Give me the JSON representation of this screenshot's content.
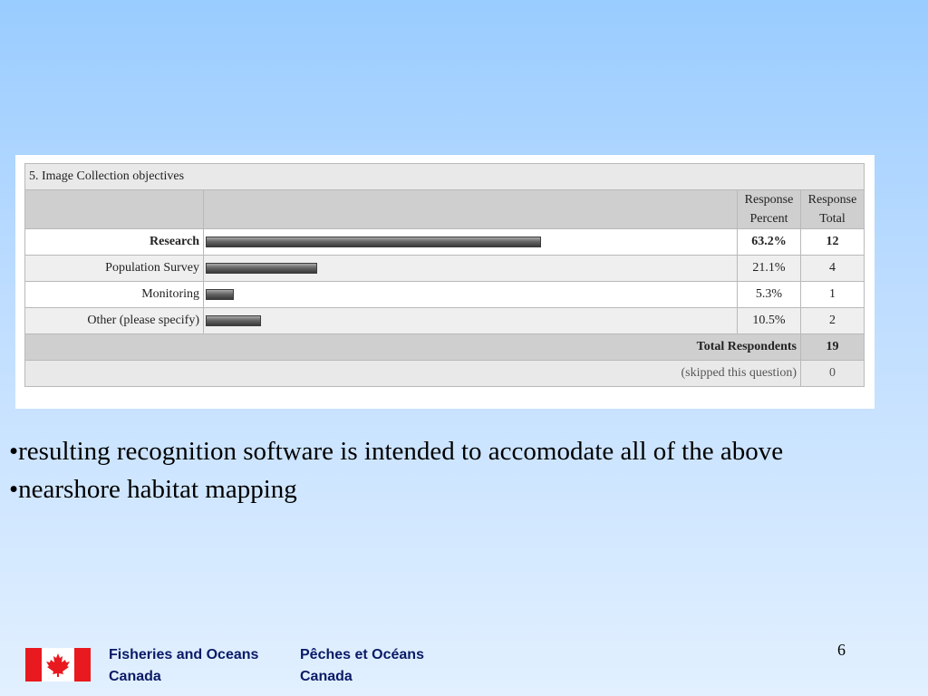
{
  "survey": {
    "question_title": "5. Image Collection objectives",
    "header": {
      "percent": [
        "Response",
        "Percent"
      ],
      "total": [
        "Response",
        "Total"
      ]
    },
    "rows": [
      {
        "label": "Research",
        "percent": "63.2%",
        "total": "12",
        "bar_value": 0.632,
        "bold": true
      },
      {
        "label": "Population Survey",
        "percent": "21.1%",
        "total": "4",
        "bar_value": 0.211,
        "bold": false
      },
      {
        "label": "Monitoring",
        "percent": "5.3%",
        "total": "1",
        "bar_value": 0.053,
        "bold": false
      },
      {
        "label": "Other (please specify)",
        "percent": "10.5%",
        "total": "2",
        "bar_value": 0.105,
        "bold": false
      }
    ],
    "total_respondents_label": "Total Respondents",
    "total_respondents_value": "19",
    "skipped_label": "(skipped this question)",
    "skipped_value": "0"
  },
  "bullets": [
    "•resulting recognition software is intended to accomodate all of the above",
    "•nearshore habitat mapping"
  ],
  "footer": {
    "english": [
      "Fisheries and Oceans",
      "Canada"
    ],
    "french": [
      "Pêches et Océans",
      "Canada"
    ],
    "flag_icon": "canada-flag-icon",
    "text_color": "#0a1a66",
    "flag_red": "#e8191f"
  },
  "slide_number": "6"
}
